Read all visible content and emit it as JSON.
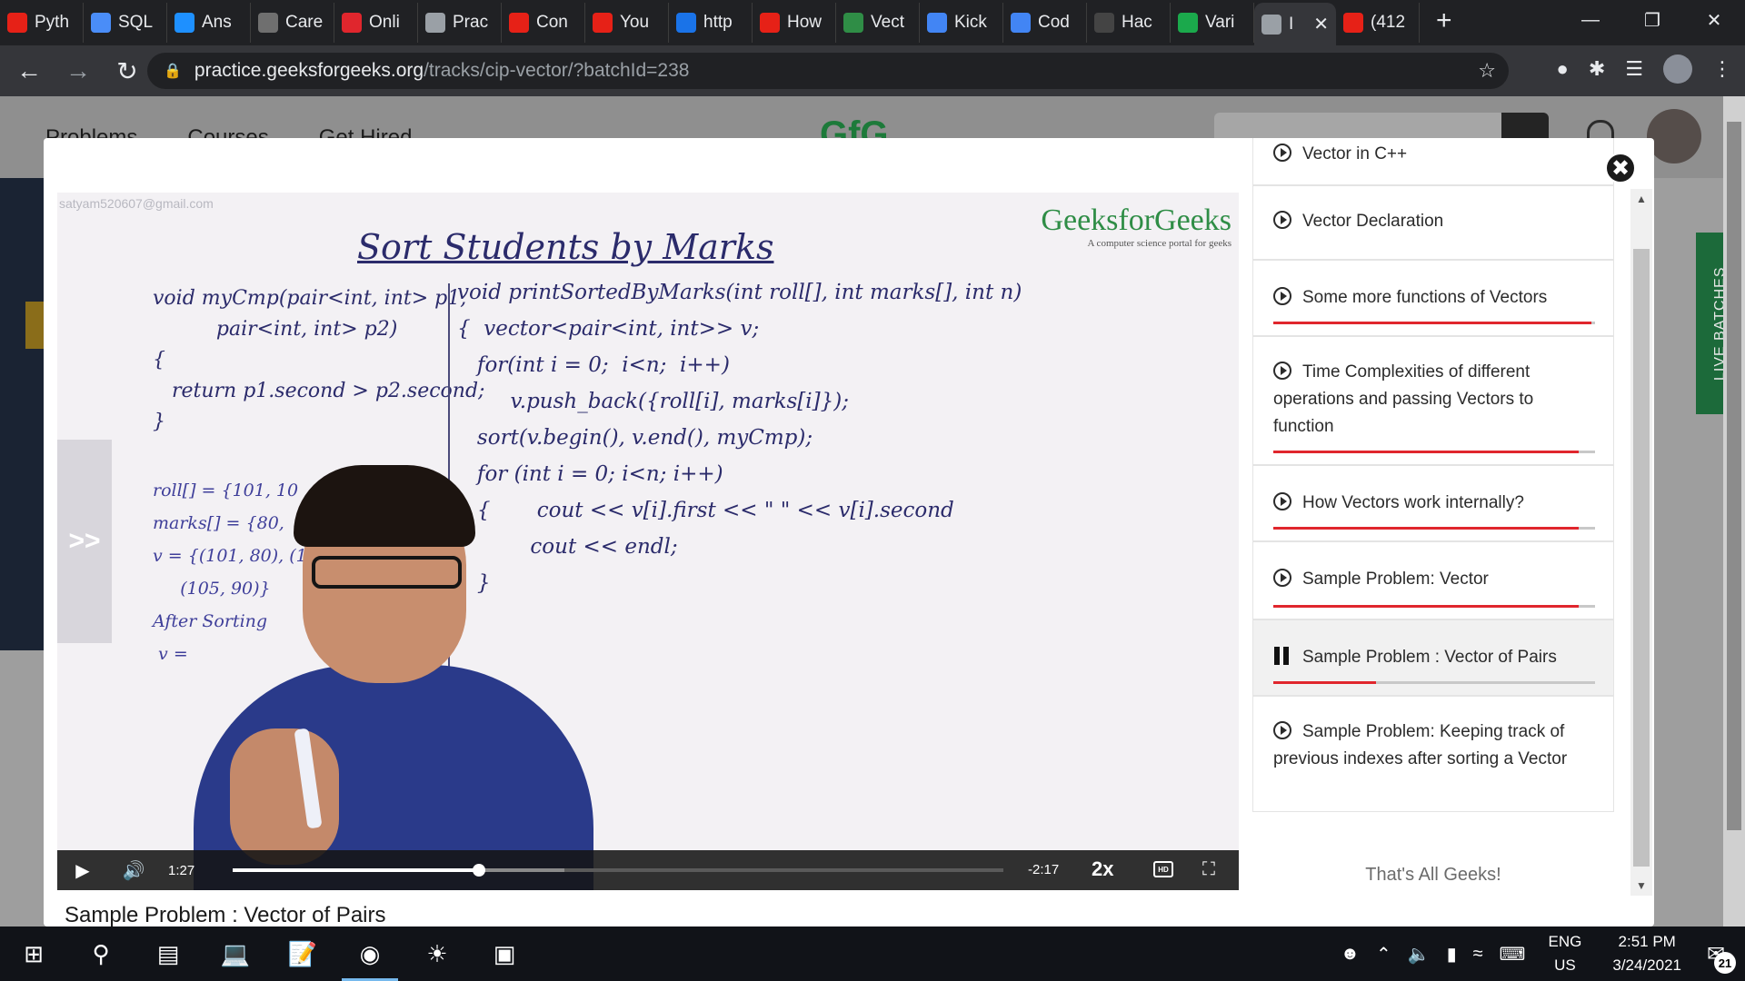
{
  "browser": {
    "tabs": [
      {
        "label": "Pyth",
        "icon": "youtube-icon",
        "color": "#e62117"
      },
      {
        "label": "SQL",
        "icon": "document-icon",
        "color": "#4a8df8"
      },
      {
        "label": "Ans",
        "icon": "answer-icon",
        "color": "#1e90ff"
      },
      {
        "label": "Care",
        "icon": "ampersand-icon",
        "color": "#6f6f6f"
      },
      {
        "label": "Onli",
        "icon": "u-logo-icon",
        "color": "#e0262d"
      },
      {
        "label": "Prac",
        "icon": "globe-icon",
        "color": "#9aa0a6"
      },
      {
        "label": "Con",
        "icon": "youtube-icon",
        "color": "#e62117"
      },
      {
        "label": "You",
        "icon": "youtube-icon",
        "color": "#e62117"
      },
      {
        "label": "http",
        "icon": "media-icon",
        "color": "#1a73e8"
      },
      {
        "label": "How",
        "icon": "youtube-icon",
        "color": "#e62117"
      },
      {
        "label": "Vect",
        "icon": "gfg-icon",
        "color": "#2f8d46"
      },
      {
        "label": "Kick",
        "icon": "google-icon",
        "color": "#4285f4"
      },
      {
        "label": "Cod",
        "icon": "google-icon",
        "color": "#4285f4"
      },
      {
        "label": "Hac",
        "icon": "github-icon",
        "color": "#444444"
      },
      {
        "label": "Vari",
        "icon": "hackerrank-icon",
        "color": "#1ba94c"
      },
      {
        "label": "I",
        "icon": "globe-icon",
        "color": "#9aa0a6",
        "active": true
      },
      {
        "label": "(412",
        "icon": "youtube-icon",
        "color": "#e62117"
      }
    ],
    "url_host": "practice.geeksforgeeks.org",
    "url_path": "/tracks/cip-vector/?batchId=238"
  },
  "site": {
    "nav": [
      "Problems",
      "Courses",
      "Get Hired"
    ],
    "logo": "GfG",
    "live_tab": "LIVE BATCHES"
  },
  "video": {
    "watermark": "satyam520607@gmail.com",
    "brand_name": "GeeksforGeeks",
    "brand_tag": "A computer science portal for geeks",
    "board_title": "Sort Students by Marks",
    "code_left": "void myCmp(pair<int, int> p1,\n          pair<int, int> p2)\n{\n   return p1.second > p2.second;\n}",
    "code_left2": "roll[] = {101, 10\nmarks[] = {80,\nv = {(101, 80), (1\n     (105, 90)}\nAfter Sorting\n v =",
    "code_right": "void printSortedByMarks(int roll[], int marks[], int n)\n{  vector<pair<int, int>> v;\n   for(int i = 0;  i<n;  i++)\n        v.push_back({roll[i], marks[i]});\n   sort(v.begin(), v.end(), myCmp);\n   for (int i = 0; i<n; i++)\n   {       cout << v[i].first << \" \" << v[i].second\n           cout << endl;\n   }",
    "side_handle": ">>",
    "current_time": "1:27",
    "remaining_time": "-2:17",
    "played_fraction": 0.32,
    "buffered_fraction": 0.43,
    "speed": "2x",
    "hd_label": "HD",
    "caption": "Sample Problem : Vector of Pairs"
  },
  "playlist": {
    "items": [
      {
        "title": "Vector in C++",
        "state": "partial",
        "progress": 1.0
      },
      {
        "title": "Vector Declaration",
        "state": "play",
        "progress": null
      },
      {
        "title": "Some more functions of Vectors",
        "state": "play",
        "progress": 0.99
      },
      {
        "title": "Time Complexities of different operations and passing Vectors to function",
        "state": "play",
        "progress": 0.95
      },
      {
        "title": "How Vectors work internally?",
        "state": "play",
        "progress": 0.95
      },
      {
        "title": "Sample Problem: Vector",
        "state": "play",
        "progress": 0.95
      },
      {
        "title": "Sample Problem : Vector of Pairs",
        "state": "playing",
        "progress": 0.32
      },
      {
        "title": "Sample Problem: Keeping track of previous indexes after sorting a Vector",
        "state": "play",
        "progress": null
      }
    ],
    "end_text": "That's All Geeks!"
  },
  "taskbar": {
    "lang_top": "ENG",
    "lang_bottom": "US",
    "time": "2:51 PM",
    "date": "3/24/2021",
    "notifications": "21"
  },
  "colors": {
    "accent_red": "#e0262d",
    "gfg_green": "#2f8d46"
  }
}
